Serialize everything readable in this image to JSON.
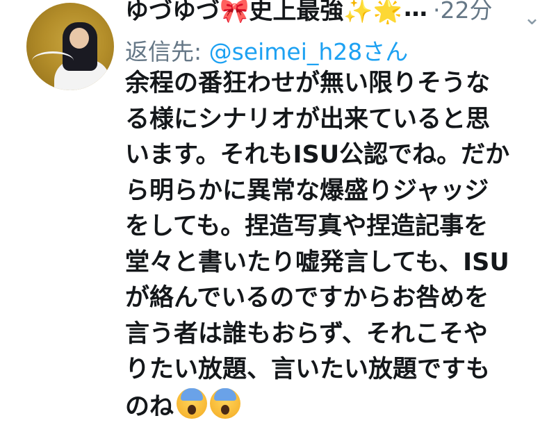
{
  "tweet": {
    "author_name": "ゆづゆづ🎀史上最強✨🌟",
    "truncation": "…",
    "separator": "·",
    "time": "22分",
    "more_icon": "chevron-down-icon",
    "reply_prefix": "返信先: ",
    "reply_handle": "@seimei_h28さん",
    "body_lines": [
      "余程の番狂わせが無い限りそうな",
      "る様にシナリオが出来ていると思",
      "います。それもISU公認でね。だか",
      "ら明らかに異常な爆盛りジャッジ",
      "をしても。捏造写真や捏造記事を",
      "堂々と書いたり嘘発言しても、ISU",
      "が絡んでいるのですからお咎めを",
      "言う者は誰もおらず、それこそや",
      "りたい放題、言いたい放題ですも",
      "のね"
    ],
    "trailing_emoji": [
      "scream-emoji",
      "scream-emoji"
    ]
  }
}
